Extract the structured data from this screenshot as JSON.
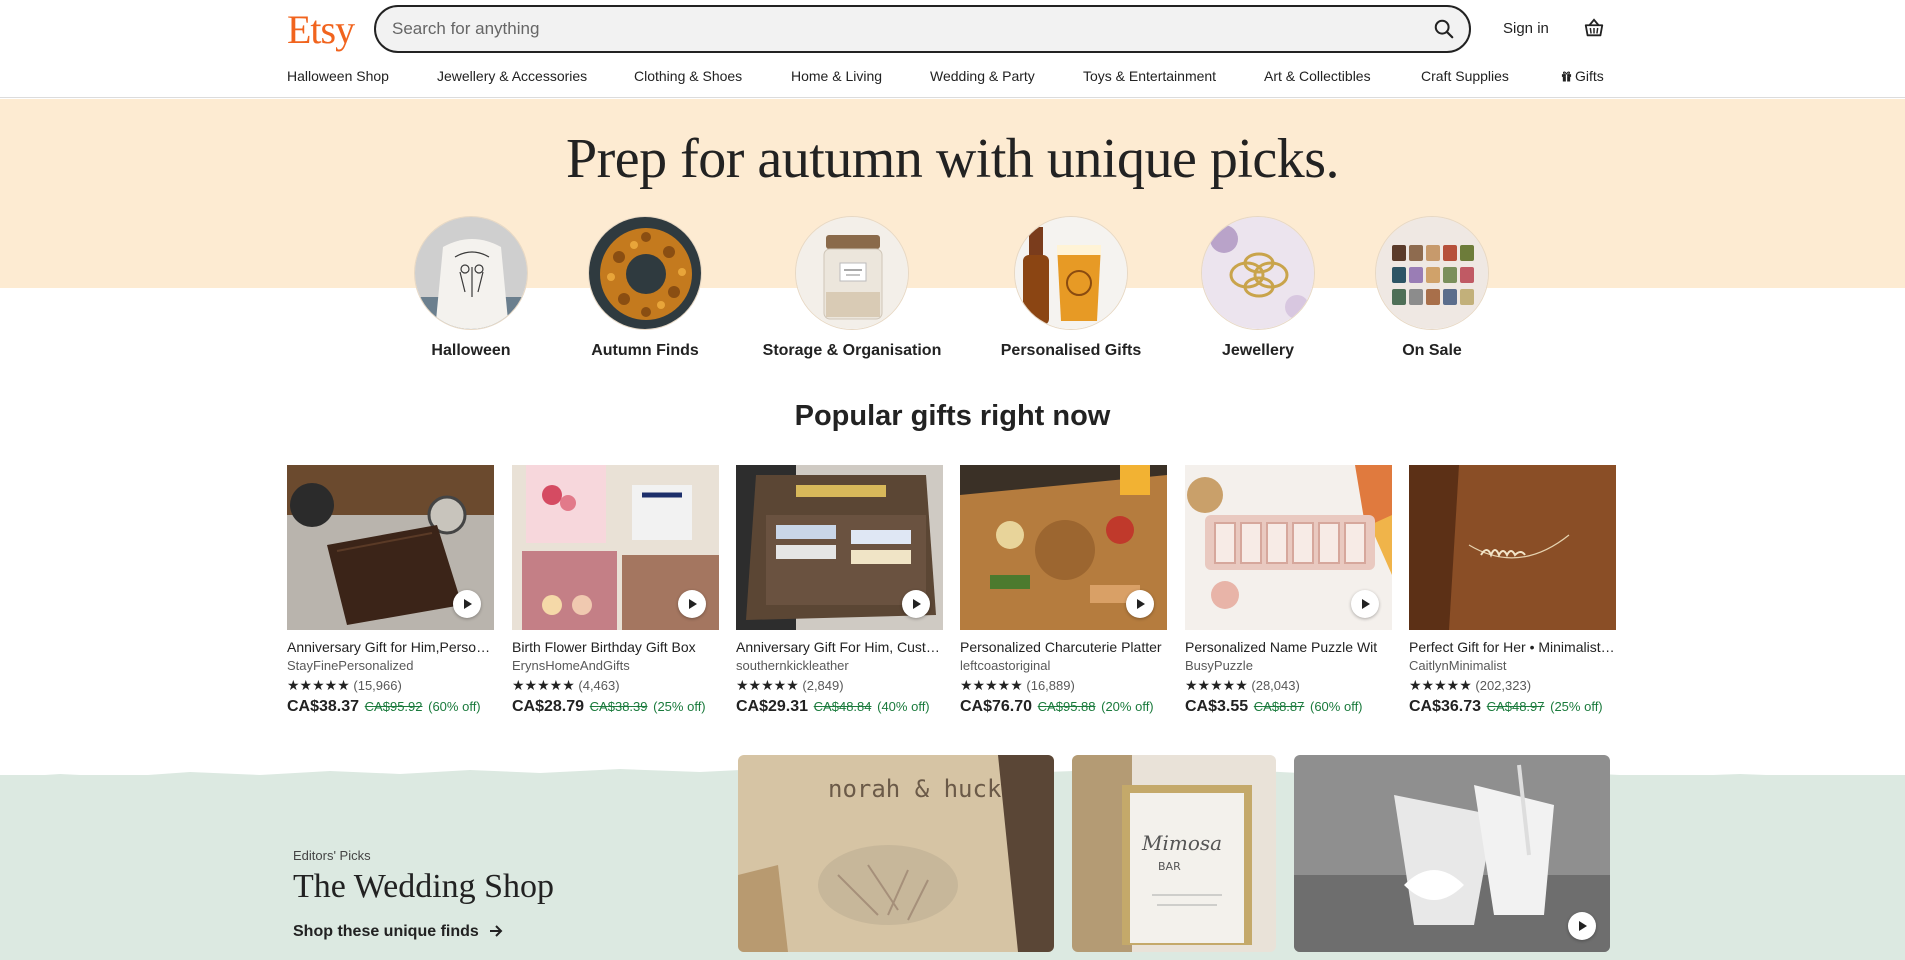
{
  "header": {
    "logo": "Etsy",
    "search_placeholder": "Search for anything",
    "signin_label": "Sign in"
  },
  "nav": {
    "items": [
      "Halloween Shop",
      "Jewellery & Accessories",
      "Clothing & Shoes",
      "Home & Living",
      "Wedding & Party",
      "Toys & Entertainment",
      "Art & Collectibles",
      "Craft Supplies",
      "Gifts"
    ]
  },
  "hero": {
    "title": "Prep for autumn with unique picks.",
    "categories": [
      "Halloween",
      "Autumn Finds",
      "Storage & Organisation",
      "Personalised Gifts",
      "Jewellery",
      "On Sale"
    ]
  },
  "popular": {
    "title": "Popular gifts right now",
    "products": [
      {
        "title": "Anniversary Gift for Him,Personalized Wallet",
        "shop": "StayFinePersonalized",
        "stars": "★★★★★",
        "reviews": "(15,966)",
        "price": "CA$38.37",
        "original": "CA$95.92",
        "discount": "(60% off)"
      },
      {
        "title": "Birth Flower Birthday Gift Box",
        "shop": "ErynsHomeAndGifts",
        "stars": "★★★★★",
        "reviews": "(4,463)",
        "price": "CA$28.79",
        "original": "CA$38.39",
        "discount": "(25% off)"
      },
      {
        "title": "Anniversary Gift For Him, Custom Wallet",
        "shop": "southernkickleather",
        "stars": "★★★★★",
        "reviews": "(2,849)",
        "price": "CA$29.31",
        "original": "CA$48.84",
        "discount": "(40% off)"
      },
      {
        "title": "Personalized Charcuterie Platter",
        "shop": "leftcoastoriginal",
        "stars": "★★★★★",
        "reviews": "(16,889)",
        "price": "CA$76.70",
        "original": "CA$95.88",
        "discount": "(20% off)"
      },
      {
        "title": "Personalized Name Puzzle Wit",
        "shop": "BusyPuzzle",
        "stars": "★★★★★",
        "reviews": "(28,043)",
        "price": "CA$3.55",
        "original": "CA$8.87",
        "discount": "(60% off)"
      },
      {
        "title": "Perfect Gift for Her • Minimalist Necklace",
        "shop": "CaitlynMinimalist",
        "stars": "★★★★★",
        "reviews": "(202,323)",
        "price": "CA$36.73",
        "original": "CA$48.97",
        "discount": "(25% off)"
      }
    ]
  },
  "wedding": {
    "eyebrow": "Editors' Picks",
    "title": "The Wedding Shop",
    "link": "Shop these unique finds",
    "image1_text": "norah & huck",
    "image2_text1": "Mimosa",
    "image2_text2": "BAR"
  },
  "colors": {
    "brand": "#F1641E",
    "hero_band": "#FDEBD2",
    "wedding_band": "#DCE9E1",
    "discount_green": "#1a7a3c"
  },
  "icons": [
    "search-icon",
    "basket-icon",
    "gift-icon",
    "play-icon",
    "arrow-right-icon"
  ]
}
